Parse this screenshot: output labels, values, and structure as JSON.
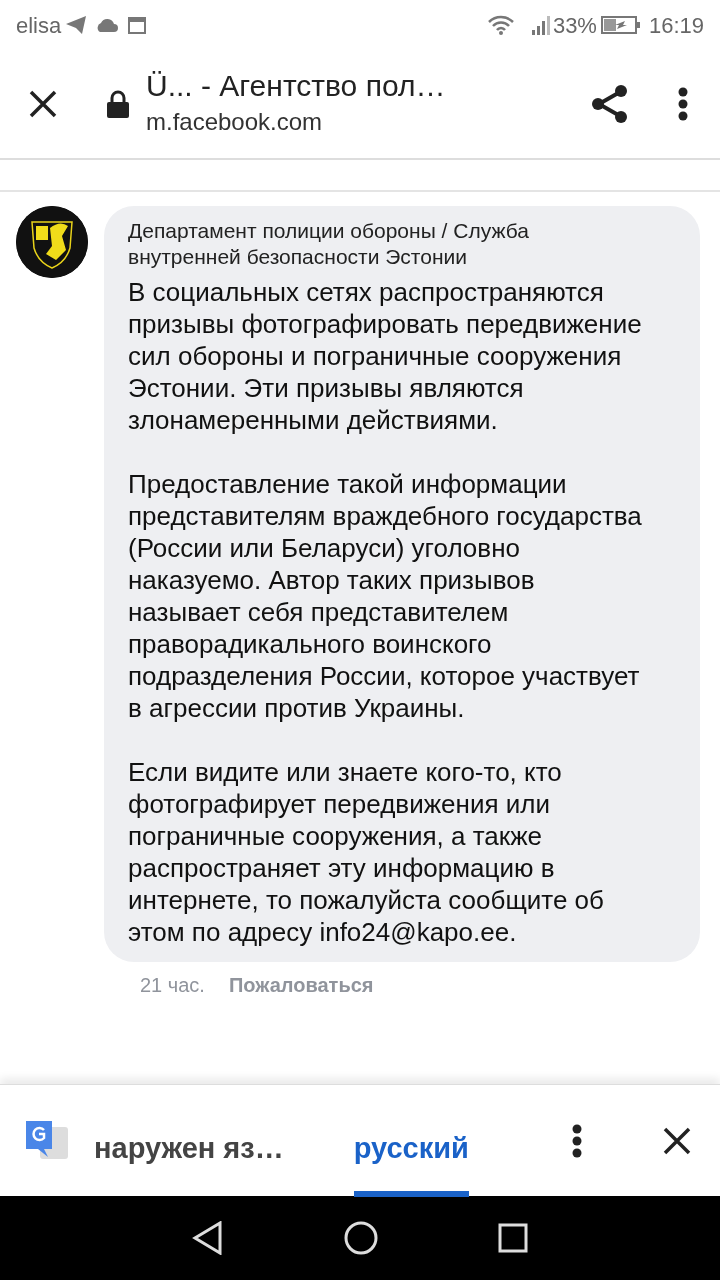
{
  "status_bar": {
    "carrier": "elisa",
    "battery_percent": "33%",
    "time": "16:19"
  },
  "browser_bar": {
    "title": "Ü... - Агентство пол…",
    "url": "m.facebook.com"
  },
  "comment": {
    "author": "Департамент полиции обороны / Служба внутренней безопасности Эстонии",
    "paragraphs": [
      "В социальных сетях распространяются призывы фотографировать передвижение сил обороны и пограничные сооружения Эстонии. Эти призывы являются злонамеренными действиями.",
      "Предоставление такой информации представителям враждебного государства (России или Беларуси) уголовно наказуемо. Автор таких призывов называет себя представителем праворадикального воинского подразделения России, которое участвует в агрессии против Украины.",
      "Если видите или знаете кого-то, кто фотографирует передвижения или пограничные сооружения, а также распространяет эту информацию в интернете, то пожалуйста сообщите об этом по адресу info24@kapo.ee."
    ],
    "time": "21 час.",
    "report_link": "Пожаловаться"
  },
  "translate_bar": {
    "tabs": [
      {
        "label": "наружен яз…",
        "selected": false
      },
      {
        "label": "русский",
        "selected": true
      }
    ]
  }
}
